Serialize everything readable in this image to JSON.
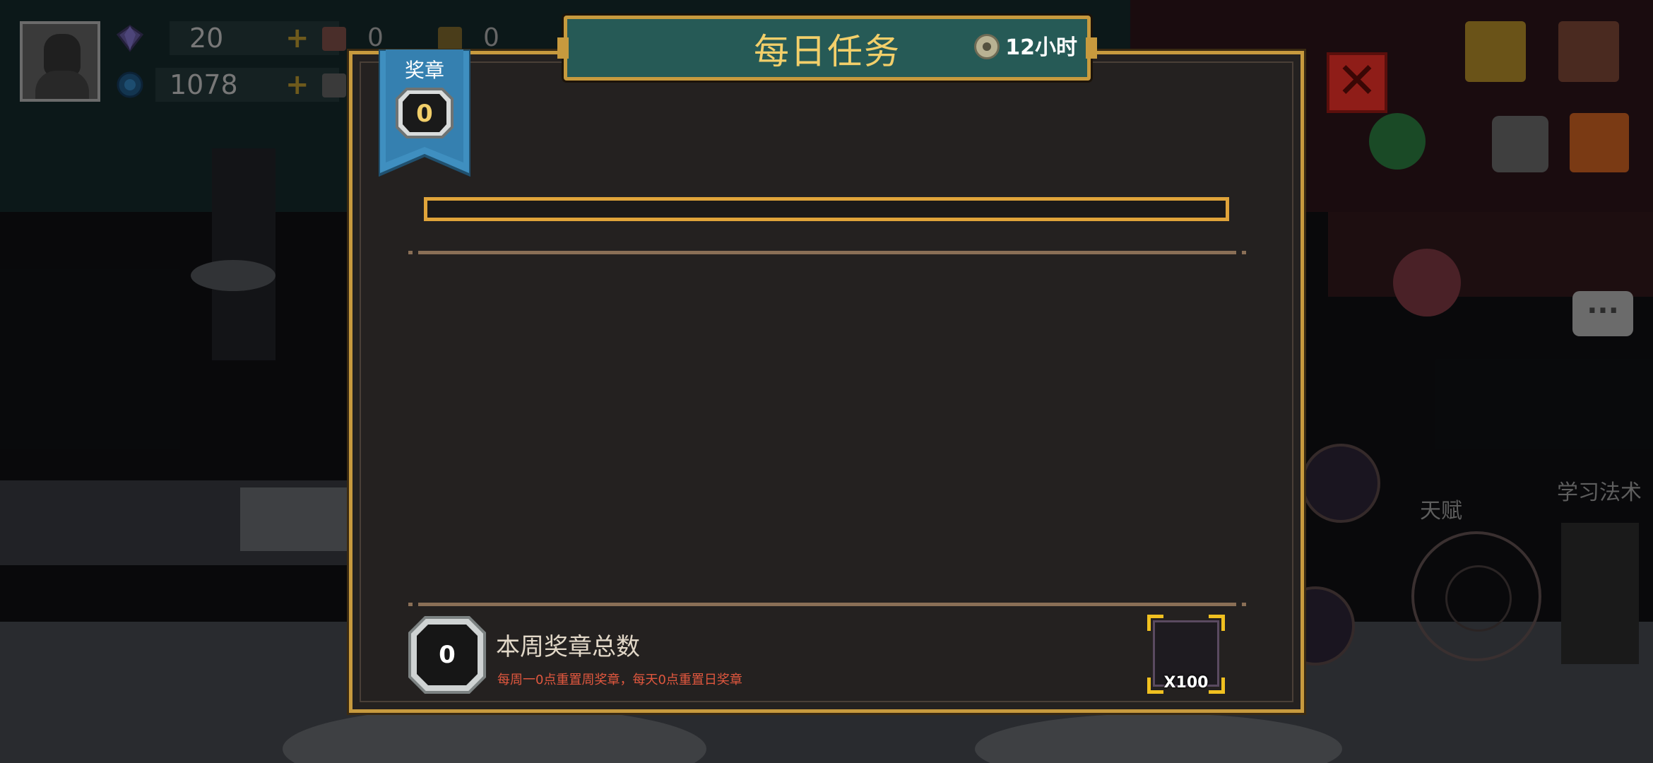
{
  "hud": {
    "gems": "20",
    "coins": "1078",
    "res_a": "0",
    "res_b": "0"
  },
  "side": {
    "labels": [
      "天赋",
      "学习法术"
    ]
  },
  "dialog": {
    "title": "每日任务",
    "timer": "12小时",
    "medal_label": "奖章",
    "medal_count": "0",
    "progress_fraction": 0,
    "weekly_count": "0",
    "weekly_title": "本周奖章总数",
    "weekly_note": "每周一0点重置周奖章，每天0点重置日奖章",
    "reward_qty": "X100"
  },
  "colors": {
    "gold": "#c79a3e",
    "banner_teal": "#265a56",
    "title_yellow": "#f2cf6a",
    "note_red": "#e0573e",
    "ribbon_blue": "#3f8fc0"
  }
}
